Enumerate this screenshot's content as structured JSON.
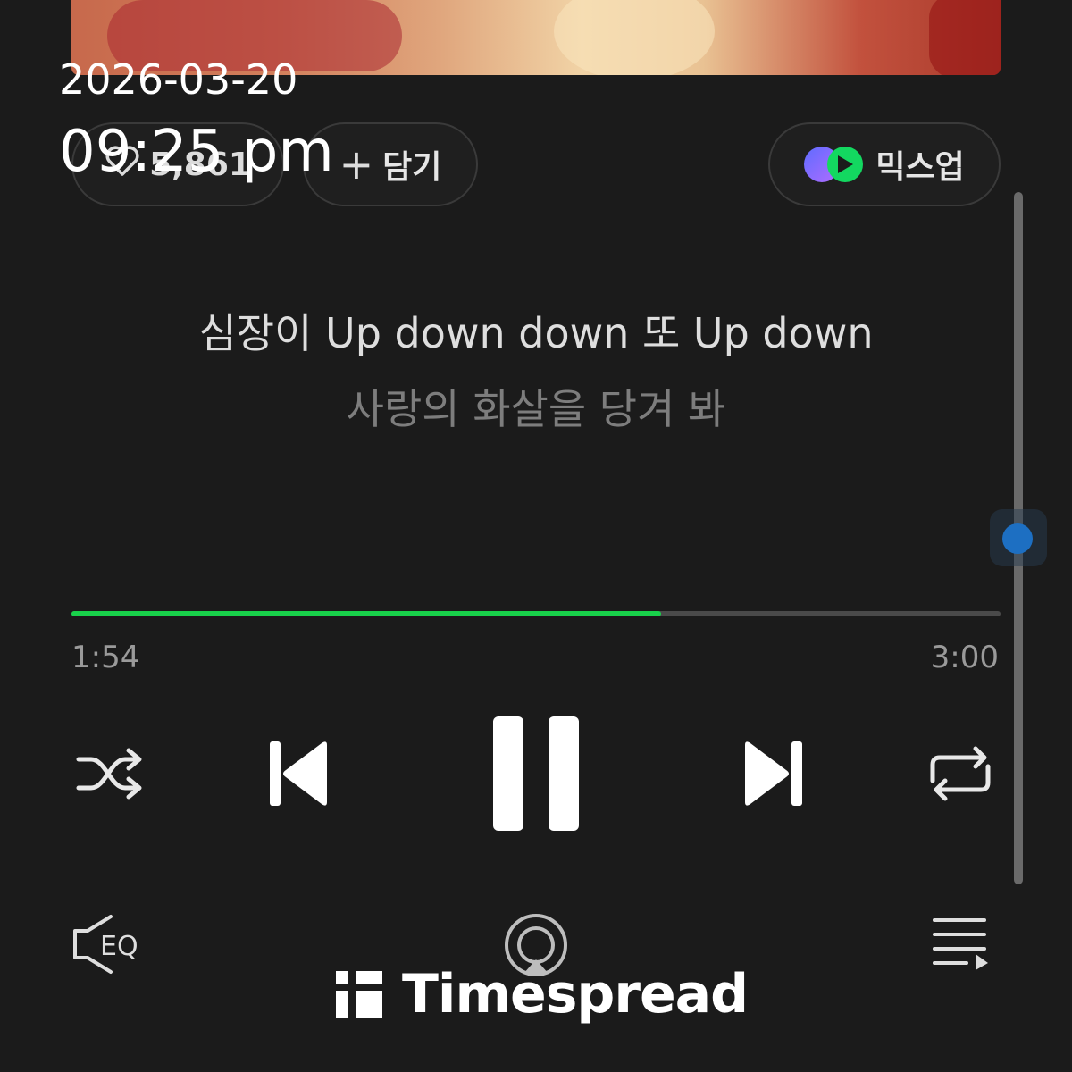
{
  "actions": {
    "like_count": "5,861",
    "add_label": "담기",
    "mixup_label": "믹스업"
  },
  "lyrics": {
    "current": "심장이 Up down down 또 Up down",
    "next": "사랑의 화살을 당겨 봐"
  },
  "playback": {
    "current_time": "1:54",
    "total_time": "3:00",
    "progress": 0.635,
    "accent_color": "#19d24b"
  },
  "controls": {
    "shuffle_icon": "shuffle-icon",
    "prev_icon": "skip-previous-icon",
    "pause_icon": "pause-icon",
    "next_icon": "skip-next-icon",
    "repeat_icon": "repeat-icon",
    "eq_label": "EQ",
    "airplay_icon": "airplay-icon",
    "playlist_icon": "playlist-icon"
  },
  "overlay": {
    "date": "2026-03-20",
    "time": "09:25 pm"
  },
  "watermark": {
    "brand": "Timespread"
  }
}
